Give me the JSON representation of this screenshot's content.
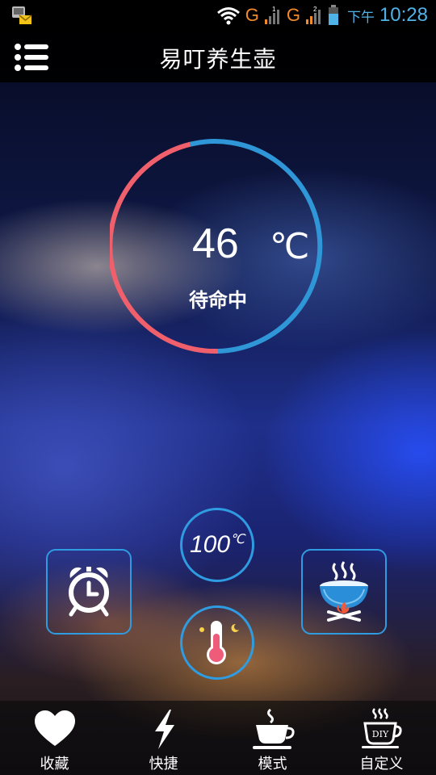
{
  "status_bar": {
    "network_1": "G",
    "sim_1": "1",
    "network_2": "G",
    "sim_2": "2",
    "ampm": "下午",
    "time": "10:28"
  },
  "header": {
    "title": "易叮养生壶",
    "menu_icon": "list-menu-icon"
  },
  "gauge": {
    "temperature": "46",
    "unit": "℃",
    "status": "待命中",
    "colors": {
      "warm": "#f0606c",
      "cool": "#2f97d8"
    }
  },
  "controls": {
    "boil_label": "100",
    "boil_unit": "℃",
    "alarm_icon": "alarm-clock-icon",
    "cook_icon": "steaming-pot-icon",
    "keepwarm_icon": "thermometer-icon",
    "accent": "#2f9be0"
  },
  "bottom_nav": {
    "items": [
      {
        "label": "收藏",
        "icon": "heart-icon"
      },
      {
        "label": "快捷",
        "icon": "lightning-icon"
      },
      {
        "label": "模式",
        "icon": "coffee-cup-icon"
      },
      {
        "label": "自定义",
        "icon": "diy-cup-icon"
      }
    ],
    "diy_badge": "DIY"
  }
}
